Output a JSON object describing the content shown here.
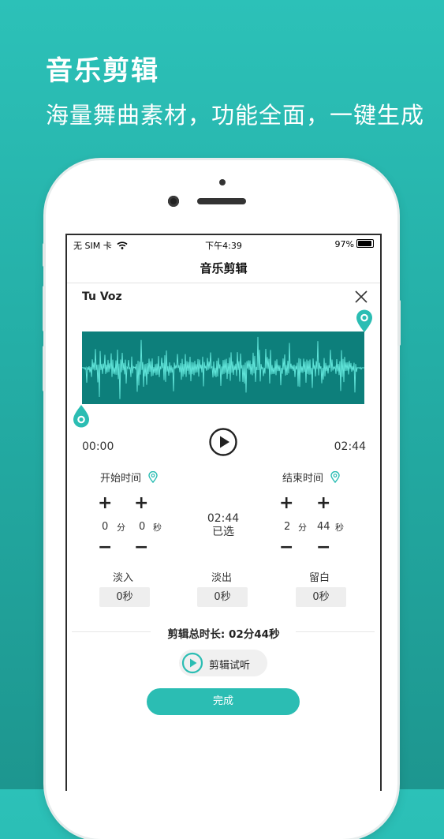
{
  "promo": {
    "title": "音乐剪辑",
    "subtitle": "海量舞曲素材，功能全面，一键生成"
  },
  "status_bar": {
    "carrier": "无 SIM 卡",
    "time": "下午4:39",
    "battery": "97%"
  },
  "nav": {
    "title": "音乐剪辑"
  },
  "song": {
    "title": "Tu Voz"
  },
  "player": {
    "current_time": "00:00",
    "duration": "02:44"
  },
  "start_time": {
    "label": "开始时间",
    "minutes": "0",
    "minutes_unit": "分",
    "seconds": "0",
    "seconds_unit": "秒"
  },
  "end_time": {
    "label": "结束时间",
    "minutes": "2",
    "minutes_unit": "分",
    "seconds": "44",
    "seconds_unit": "秒"
  },
  "selection": {
    "time": "02:44",
    "label": "已选"
  },
  "stepper": {
    "plus": "+",
    "minus": "−"
  },
  "effects": {
    "fade_in": {
      "label": "淡入",
      "value": "0秒"
    },
    "fade_out": {
      "label": "淡出",
      "value": "0秒"
    },
    "blank": {
      "label": "留白",
      "value": "0秒"
    }
  },
  "total": {
    "text": "剪辑总时长: 02分44秒"
  },
  "buttons": {
    "preview": "剪辑试听",
    "done": "完成"
  },
  "colors": {
    "accent": "#2bbdb3",
    "waveform_bg": "#0d7f7b",
    "waveform_line": "#5fe3d8"
  }
}
